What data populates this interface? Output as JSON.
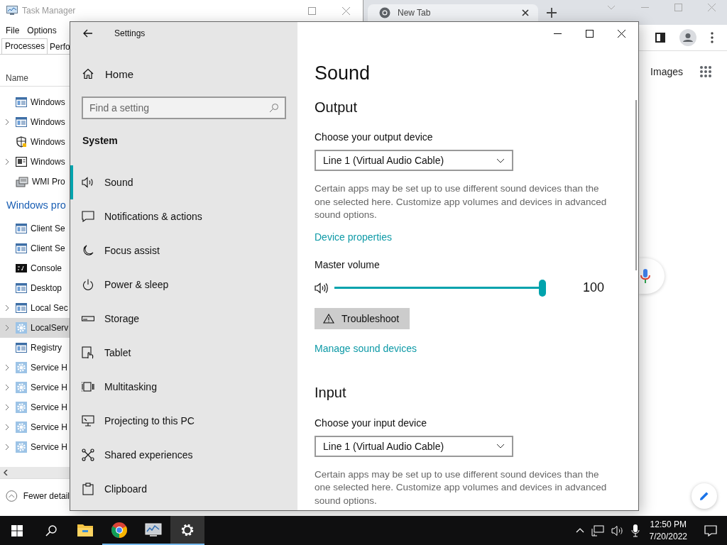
{
  "task_manager": {
    "title": "Task Manager",
    "menu": [
      "File",
      "Options"
    ],
    "tabs": [
      {
        "label": "Processes",
        "selected": true
      },
      {
        "label": "Perfo",
        "selected": false
      }
    ],
    "column": "Name",
    "rows": [
      {
        "kind": "app",
        "name": "Windows",
        "expandable": false,
        "selected": false
      },
      {
        "kind": "app",
        "name": "Windows",
        "expandable": true,
        "selected": false
      },
      {
        "kind": "shield",
        "name": "Windows",
        "expandable": false,
        "selected": false
      },
      {
        "kind": "monitor",
        "name": "Windows",
        "expandable": true,
        "selected": false
      },
      {
        "kind": "server",
        "name": "WMI Pro",
        "expandable": false,
        "selected": false
      },
      {
        "kind": "group",
        "name": "Windows pro"
      },
      {
        "kind": "app",
        "name": "Client Se",
        "expandable": false,
        "selected": false
      },
      {
        "kind": "app",
        "name": "Client Se",
        "expandable": false,
        "selected": false
      },
      {
        "kind": "console",
        "name": "Console",
        "expandable": false,
        "selected": false
      },
      {
        "kind": "app",
        "name": "Desktop",
        "expandable": false,
        "selected": false
      },
      {
        "kind": "app",
        "name": "Local Sec",
        "expandable": true,
        "selected": false
      },
      {
        "kind": "gear",
        "name": "LocalServ",
        "expandable": true,
        "selected": true
      },
      {
        "kind": "app",
        "name": "Registry",
        "expandable": false,
        "selected": false
      },
      {
        "kind": "gear",
        "name": "Service H",
        "expandable": true,
        "selected": false
      },
      {
        "kind": "gear",
        "name": "Service H",
        "expandable": true,
        "selected": false
      },
      {
        "kind": "gear",
        "name": "Service H",
        "expandable": true,
        "selected": false
      },
      {
        "kind": "gear",
        "name": "Service H",
        "expandable": true,
        "selected": false
      },
      {
        "kind": "gear",
        "name": "Service H",
        "expandable": true,
        "selected": false
      }
    ],
    "footer": "Fewer detail"
  },
  "chrome": {
    "tab": "New Tab",
    "links": [
      "Images"
    ]
  },
  "settings": {
    "title": "Settings",
    "home": "Home",
    "search": {
      "placeholder": "Find a setting"
    },
    "section": "System",
    "nav": [
      {
        "label": "Sound",
        "kind": "sound",
        "selected": true
      },
      {
        "label": "Notifications & actions",
        "kind": "notifications",
        "selected": false
      },
      {
        "label": "Focus assist",
        "kind": "moon",
        "selected": false
      },
      {
        "label": "Power & sleep",
        "kind": "power",
        "selected": false
      },
      {
        "label": "Storage",
        "kind": "storage",
        "selected": false
      },
      {
        "label": "Tablet",
        "kind": "tablet",
        "selected": false
      },
      {
        "label": "Multitasking",
        "kind": "multitasking",
        "selected": false
      },
      {
        "label": "Projecting to this PC",
        "kind": "projecting",
        "selected": false
      },
      {
        "label": "Shared experiences",
        "kind": "shared",
        "selected": false
      },
      {
        "label": "Clipboard",
        "kind": "clipboard",
        "selected": false
      }
    ],
    "page": {
      "title": "Sound",
      "output": {
        "heading": "Output",
        "device_label": "Choose your output device",
        "device": "Line 1 (Virtual Audio Cable)",
        "description": "Certain apps may be set up to use different sound devices than the one selected here. Customize app volumes and devices in advanced sound options.",
        "properties_link": "Device properties",
        "volume": {
          "label": "Master volume",
          "level": 1,
          "reading": "100"
        },
        "troubleshoot": "Troubleshoot",
        "manage_link": "Manage sound devices"
      },
      "input": {
        "heading": "Input",
        "device_label": "Choose your input device",
        "device": "Line 1 (Virtual Audio Cable)",
        "description": "Certain apps may be set up to use different sound devices than the one selected here. Customize app volumes and devices in advanced sound options."
      }
    }
  },
  "taskbar": {
    "apps": [
      {
        "kind": "explorer",
        "running": false,
        "selected": false
      },
      {
        "kind": "chrome",
        "running": true,
        "selected": false
      },
      {
        "kind": "taskmgr",
        "running": true,
        "selected": false
      },
      {
        "kind": "settings",
        "running": true,
        "selected": true
      }
    ],
    "time": "12:50 PM",
    "date": "7/20/2022"
  }
}
